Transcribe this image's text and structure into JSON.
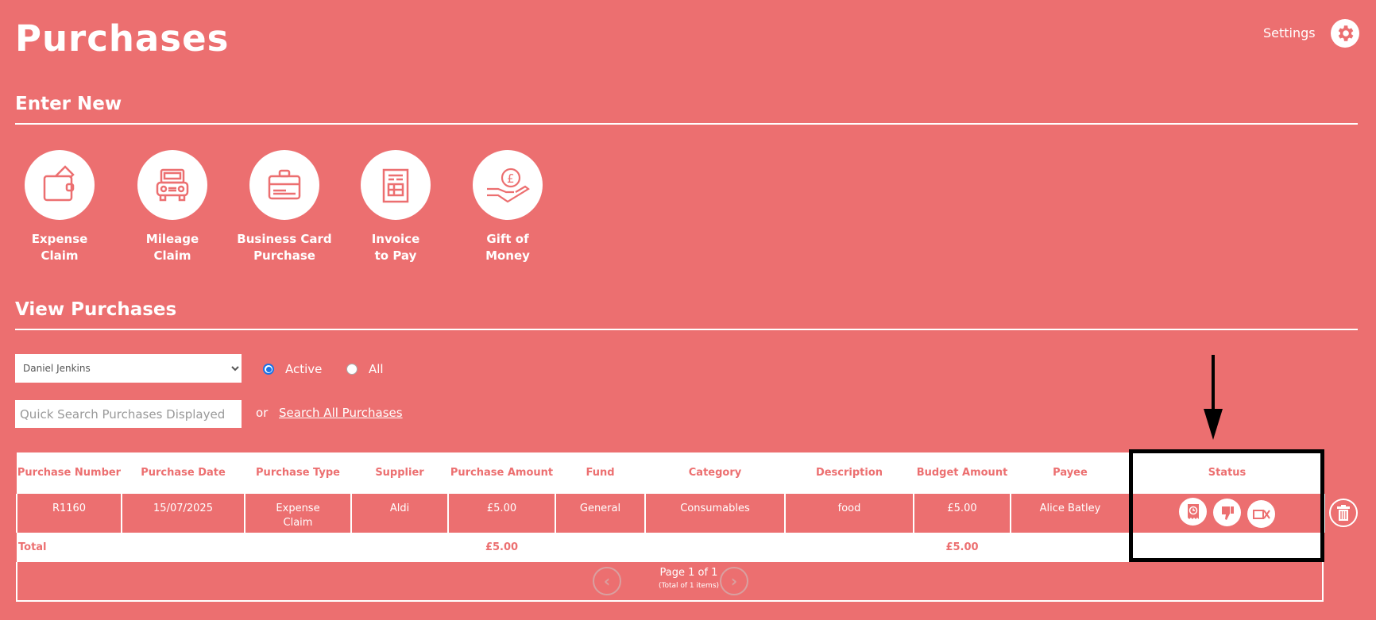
{
  "header": {
    "title": "Purchases",
    "settings_label": "Settings"
  },
  "enter_new": {
    "heading": "Enter New",
    "tiles": [
      {
        "label1": "Expense",
        "label2": "Claim",
        "icon": "wallet-icon"
      },
      {
        "label1": "Mileage",
        "label2": "Claim",
        "icon": "car-icon"
      },
      {
        "label1": "Business Card",
        "label2": "Purchase",
        "icon": "briefcase-card-icon"
      },
      {
        "label1": "Invoice",
        "label2": "to Pay",
        "icon": "invoice-icon"
      },
      {
        "label1": "Gift of",
        "label2": "Money",
        "icon": "hand-coin-icon"
      }
    ]
  },
  "view": {
    "heading": "View Purchases",
    "user_select": "Daniel Jenkins",
    "radio_active": "Active",
    "radio_all": "All",
    "search_placeholder": "Quick Search Purchases Displayed",
    "or": "or",
    "search_all": "Search All Purchases"
  },
  "table": {
    "headers": [
      "Purchase Number",
      "Purchase Date",
      "Purchase Type",
      "Supplier",
      "Purchase Amount",
      "Fund",
      "Category",
      "Description",
      "Budget Amount",
      "Payee",
      "Status"
    ],
    "rows": [
      {
        "number": "R1160",
        "date": "15/07/2025",
        "type": "Expense Claim",
        "supplier": "Aldi",
        "amount": "£5.00",
        "fund": "General",
        "category": "Consumables",
        "description": "food",
        "budget": "£5.00",
        "payee": "Alice Batley",
        "status_icons": [
          "receipt-clock-icon",
          "thumbs-down-icon",
          "no-video-icon"
        ]
      }
    ],
    "total_label": "Total",
    "total_amount": "£5.00",
    "total_budget": "£5.00"
  },
  "pager": {
    "page": "Page 1 of 1",
    "total": "(Total of 1 items)"
  },
  "colors": {
    "brand": "#ec6f70",
    "highlight": "#000000"
  }
}
